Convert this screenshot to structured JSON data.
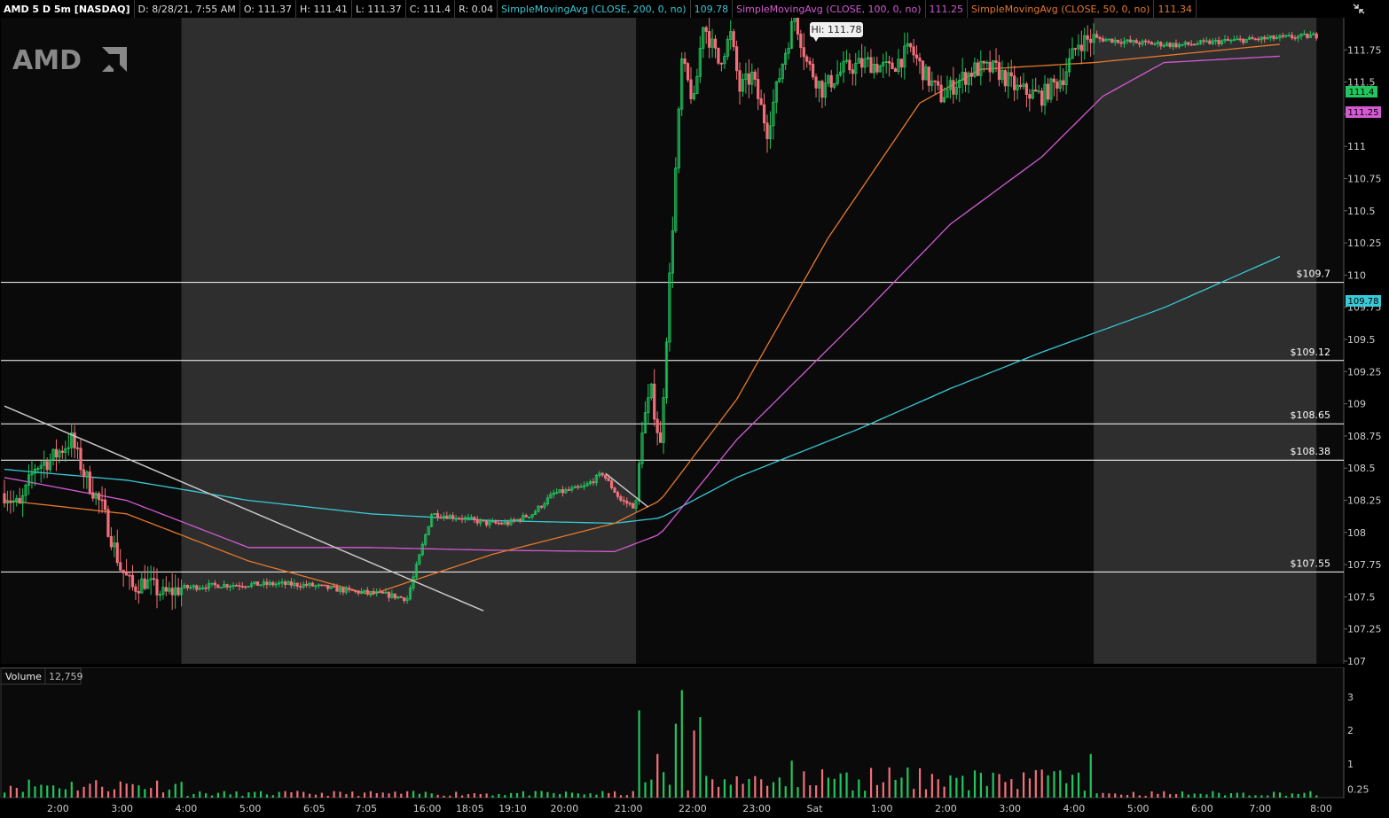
{
  "header": {
    "symbol": "AMD 5 D 5m [NASDAQ]",
    "date": "D: 8/28/21, 7:55 AM",
    "open": "O: 111.37",
    "high": "H: 111.41",
    "low": "L: 111.37",
    "close": "C: 111.4",
    "range": "R: 0.04",
    "sma200_label": "SimpleMovingAvg (CLOSE, 200, 0, no)",
    "sma200_value": "109.78",
    "sma100_label": "SimpleMovingAvg (CLOSE, 100, 0, no)",
    "sma100_value": "111.25",
    "sma50_label": "SimpleMovingAvg (CLOSE, 50, 0, no)",
    "sma50_value": "111.34",
    "corner_icon": "collapse-icon"
  },
  "logo_text": "AMD",
  "hi_label": "Hi: 111.78",
  "price_badges": {
    "last": "111.4",
    "sma100": "111.25",
    "sma200": "109.78"
  },
  "volume_label": "Volume",
  "volume_value": "12,759",
  "colors": {
    "up": "#22c55e",
    "down": "#f0707a",
    "sma200": "#38c9d6",
    "sma100": "#d45ad4",
    "sma50": "#e6782c",
    "afterhours": "#2e2e2e",
    "background": "#0a0a0a",
    "level": "#ffffff",
    "trendline": "#c8c8c8"
  },
  "chart_data": [
    {
      "type": "candlestick",
      "title": "AMD 5 D 5m [NASDAQ]",
      "y_axis": {
        "min": 107.0,
        "max": 111.75,
        "ticks": [
          "111.75",
          "111.5",
          "111.25",
          "111",
          "110.75",
          "110.5",
          "110.25",
          "110",
          "109.75",
          "109.5",
          "109.25",
          "109",
          "108.75",
          "108.5",
          "108.25",
          "108",
          "107.75",
          "107.5",
          "107.25",
          "107"
        ]
      },
      "x_ticks": [
        "2:00",
        "3:00",
        "4:00",
        "5:00",
        "6:05",
        "7:05",
        "16:00",
        "18:05",
        "19:10",
        "20:00",
        "21:00",
        "22:00",
        "23:00",
        "Sat",
        "1:00",
        "2:00",
        "3:00",
        "4:00",
        "5:00",
        "6:00",
        "7:00",
        "8:00"
      ],
      "levels": [
        {
          "label": "$109.7",
          "value": 109.7
        },
        {
          "label": "$109.12",
          "value": 109.12
        },
        {
          "label": "$108.65",
          "value": 108.65
        },
        {
          "label": "$108.38",
          "value": 108.38
        },
        {
          "label": "$107.55",
          "value": 107.55
        }
      ],
      "session_shading": [
        {
          "from_bar": 58,
          "to_bar": 207,
          "kind": "after-hours"
        },
        {
          "from_bar": 357,
          "to_bar": 430,
          "kind": "after-hours"
        }
      ],
      "trendlines": [
        {
          "from": {
            "bar": 0,
            "price": 108.65
          },
          "to": {
            "bar": 157,
            "price": 107.13
          }
        },
        {
          "from": {
            "bar": 197,
            "price": 108.15
          },
          "to": {
            "bar": 211,
            "price": 107.9
          }
        }
      ],
      "hi_marker": {
        "bar": 258,
        "price": 111.78
      },
      "price_anchors": [
        [
          0,
          108.0
        ],
        [
          5,
          107.9
        ],
        [
          10,
          108.2
        ],
        [
          15,
          108.25
        ],
        [
          22,
          108.4
        ],
        [
          26,
          108.15
        ],
        [
          32,
          107.9
        ],
        [
          38,
          107.45
        ],
        [
          42,
          107.3
        ],
        [
          46,
          107.35
        ],
        [
          52,
          107.25
        ],
        [
          58,
          107.3
        ],
        [
          70,
          107.32
        ],
        [
          90,
          107.33
        ],
        [
          100,
          107.32
        ],
        [
          112,
          107.28
        ],
        [
          125,
          107.25
        ],
        [
          132,
          107.22
        ],
        [
          140,
          107.85
        ],
        [
          150,
          107.82
        ],
        [
          158,
          107.78
        ],
        [
          165,
          107.78
        ],
        [
          173,
          107.85
        ],
        [
          180,
          108.0
        ],
        [
          190,
          108.05
        ],
        [
          196,
          108.15
        ],
        [
          202,
          107.95
        ],
        [
          207,
          107.9
        ],
        [
          209,
          108.5
        ],
        [
          212,
          108.75
        ],
        [
          215,
          108.35
        ],
        [
          218,
          109.6
        ],
        [
          220,
          110.4
        ],
        [
          222,
          111.2
        ],
        [
          226,
          110.9
        ],
        [
          229,
          111.5
        ],
        [
          234,
          111.2
        ],
        [
          238,
          111.4
        ],
        [
          241,
          111.0
        ],
        [
          245,
          111.1
        ],
        [
          250,
          110.7
        ],
        [
          255,
          111.2
        ],
        [
          259,
          111.55
        ],
        [
          263,
          111.2
        ],
        [
          268,
          111.0
        ],
        [
          275,
          111.15
        ],
        [
          283,
          111.2
        ],
        [
          290,
          111.15
        ],
        [
          297,
          111.3
        ],
        [
          302,
          111.1
        ],
        [
          307,
          110.95
        ],
        [
          312,
          111.05
        ],
        [
          318,
          111.15
        ],
        [
          325,
          111.15
        ],
        [
          332,
          111.0
        ],
        [
          340,
          110.95
        ],
        [
          347,
          111.1
        ],
        [
          352,
          111.35
        ],
        [
          357,
          111.38
        ],
        [
          370,
          111.35
        ],
        [
          385,
          111.33
        ],
        [
          400,
          111.36
        ],
        [
          415,
          111.38
        ],
        [
          430,
          111.4
        ]
      ],
      "sma200_anchors": [
        [
          0,
          108.18
        ],
        [
          40,
          108.1
        ],
        [
          80,
          107.95
        ],
        [
          120,
          107.85
        ],
        [
          160,
          107.8
        ],
        [
          200,
          107.78
        ],
        [
          215,
          107.82
        ],
        [
          240,
          108.12
        ],
        [
          280,
          108.48
        ],
        [
          310,
          108.78
        ],
        [
          340,
          109.05
        ],
        [
          380,
          109.38
        ],
        [
          420,
          109.78
        ]
      ],
      "sma100_anchors": [
        [
          0,
          108.12
        ],
        [
          40,
          107.95
        ],
        [
          80,
          107.6
        ],
        [
          120,
          107.6
        ],
        [
          160,
          107.58
        ],
        [
          200,
          107.57
        ],
        [
          215,
          107.7
        ],
        [
          240,
          108.4
        ],
        [
          280,
          109.3
        ],
        [
          310,
          110.0
        ],
        [
          340,
          110.5
        ],
        [
          360,
          110.95
        ],
        [
          380,
          111.2
        ],
        [
          420,
          111.25
        ]
      ],
      "sma50_anchors": [
        [
          0,
          107.95
        ],
        [
          40,
          107.85
        ],
        [
          80,
          107.5
        ],
        [
          120,
          107.25
        ],
        [
          160,
          107.55
        ],
        [
          200,
          107.78
        ],
        [
          215,
          107.95
        ],
        [
          240,
          108.7
        ],
        [
          270,
          109.9
        ],
        [
          300,
          110.9
        ],
        [
          320,
          111.15
        ],
        [
          357,
          111.2
        ],
        [
          420,
          111.34
        ]
      ],
      "volume": {
        "ylim": [
          0,
          3.3
        ],
        "ticks": [
          "3",
          "2",
          "1",
          "0.25"
        ],
        "spikes": [
          [
            208,
            2.6
          ],
          [
            215,
            1.3
          ],
          [
            220,
            2.2
          ],
          [
            223,
            3.2
          ],
          [
            226,
            2.0
          ],
          [
            229,
            2.4
          ],
          [
            258,
            1.1
          ],
          [
            357,
            1.3
          ]
        ]
      }
    }
  ]
}
